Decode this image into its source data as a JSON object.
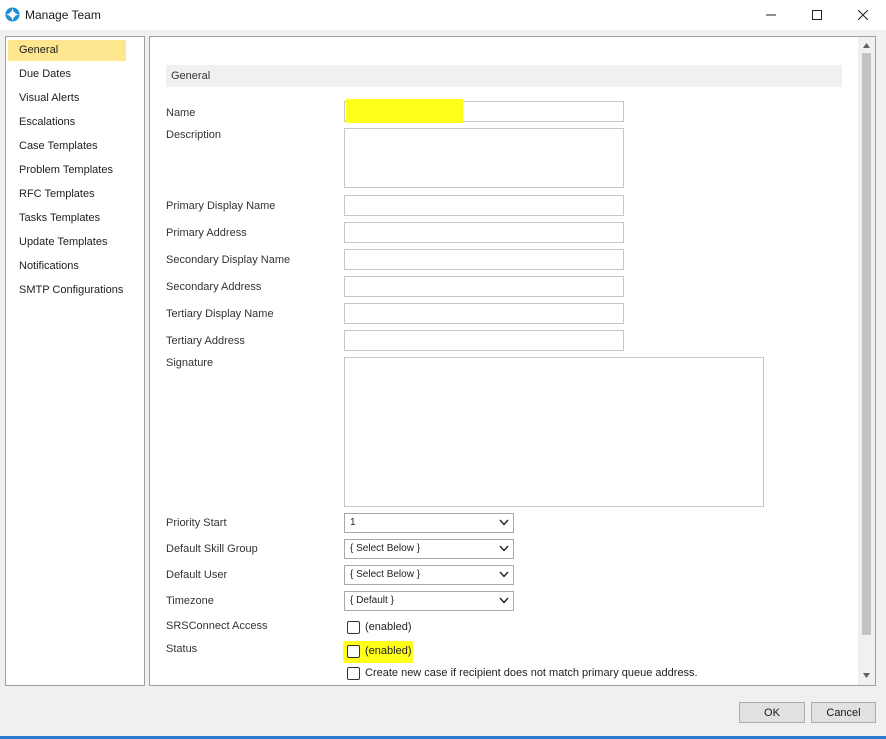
{
  "window": {
    "title": "Manage Team"
  },
  "sidebar": {
    "items": [
      {
        "label": "General",
        "selected": true
      },
      {
        "label": "Due Dates"
      },
      {
        "label": "Visual Alerts"
      },
      {
        "label": "Escalations"
      },
      {
        "label": "Case Templates"
      },
      {
        "label": "Problem Templates"
      },
      {
        "label": "RFC Templates"
      },
      {
        "label": "Tasks Templates"
      },
      {
        "label": "Update Templates"
      },
      {
        "label": "Notifications"
      },
      {
        "label": "SMTP Configurations"
      }
    ]
  },
  "form": {
    "section_title": "General",
    "name": {
      "label": "Name",
      "value": ""
    },
    "description": {
      "label": "Description",
      "value": ""
    },
    "primary_display_name": {
      "label": "Primary Display Name",
      "value": ""
    },
    "primary_address": {
      "label": "Primary Address",
      "value": ""
    },
    "secondary_display_name": {
      "label": "Secondary Display Name",
      "value": ""
    },
    "secondary_address": {
      "label": "Secondary Address",
      "value": ""
    },
    "tertiary_display_name": {
      "label": "Tertiary Display Name",
      "value": ""
    },
    "tertiary_address": {
      "label": "Tertiary Address",
      "value": ""
    },
    "signature": {
      "label": "Signature",
      "value": ""
    },
    "priority_start": {
      "label": "Priority Start",
      "value": "1"
    },
    "default_skill_group": {
      "label": "Default Skill Group",
      "value": "{ Select Below }"
    },
    "default_user": {
      "label": "Default User",
      "value": "{ Select Below }"
    },
    "timezone": {
      "label": "Timezone",
      "value": "{ Default }"
    },
    "srsconnect_access": {
      "label": "SRSConnect Access",
      "checkbox_label": "(enabled)",
      "checked": false
    },
    "status": {
      "label": "Status",
      "checkbox_label": "(enabled)",
      "checked": false
    },
    "create_new_case": {
      "checkbox_label": "Create new case if recipient does not match primary queue address.",
      "checked": false
    }
  },
  "buttons": {
    "ok": "OK",
    "cancel": "Cancel"
  },
  "colors": {
    "highlight": "#ffff19",
    "selected_nav": "#fde68d",
    "accent": "#2b7bd1"
  }
}
